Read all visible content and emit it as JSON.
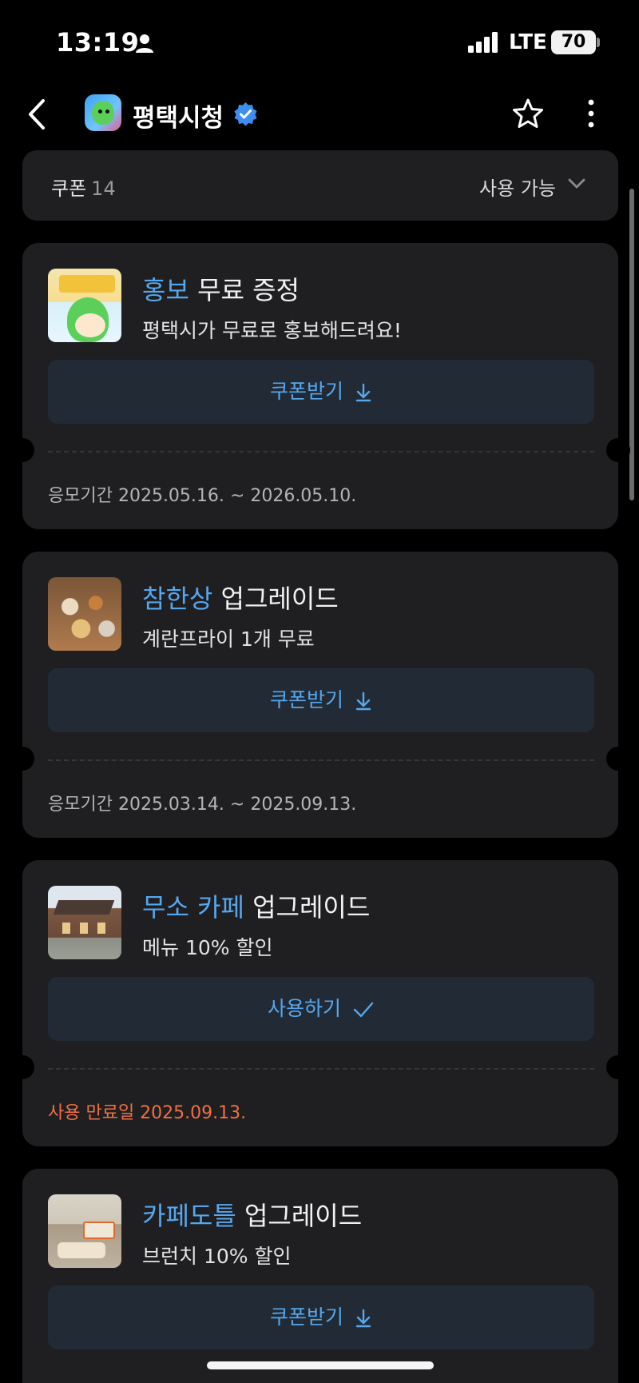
{
  "status_bar": {
    "time": "13:19",
    "network": "LTE",
    "battery": "70"
  },
  "header": {
    "title": "평택시청",
    "icons": [
      "back-arrow-icon",
      "city-logo",
      "verified-badge-icon",
      "star-icon",
      "more-vertical-icon"
    ]
  },
  "filter": {
    "label": "쿠폰",
    "count": "14",
    "sort_value": "사용 가능"
  },
  "coupons": [
    {
      "highlight": "홍보",
      "rest": " 무료 증정",
      "description": "평택시가 무료로 홍보해드려요!",
      "action": "쿠폰받기",
      "action_icon": "download-icon",
      "period": "응모기간 2025.05.16. ~ 2026.05.10."
    },
    {
      "highlight": "참한상",
      "rest": " 업그레이드",
      "description": "계란프라이 1개 무료",
      "action": "쿠폰받기",
      "action_icon": "download-icon",
      "period": "응모기간 2025.03.14. ~ 2025.09.13."
    },
    {
      "highlight": "무소 카페",
      "rest": " 업그레이드",
      "description": "메뉴 10% 할인",
      "action": "사용하기",
      "action_icon": "check-icon",
      "period": "사용 만료일 2025.09.13."
    },
    {
      "highlight": "카페도틀",
      "rest": " 업그레이드",
      "description": "브런치 10% 할인",
      "action": "쿠폰받기",
      "action_icon": "download-icon"
    }
  ],
  "colors": {
    "accent": "#56a7ee",
    "warning": "#f07042",
    "card_bg": "#1f1f21",
    "action_bg": "#222b35"
  }
}
